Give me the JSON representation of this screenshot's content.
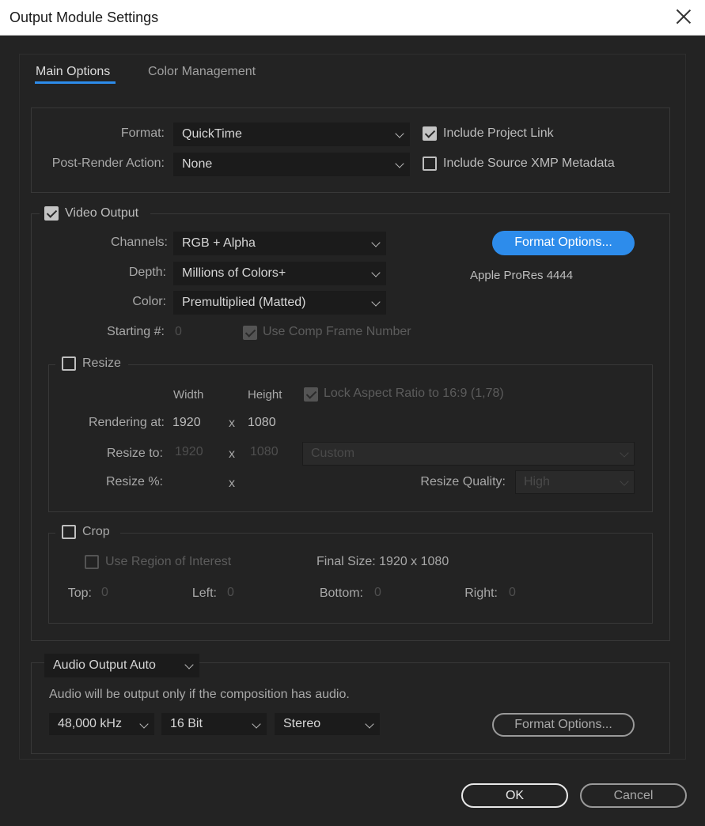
{
  "window": {
    "title": "Output Module Settings"
  },
  "tabs": [
    {
      "label": "Main Options",
      "active": true
    },
    {
      "label": "Color Management",
      "active": false
    }
  ],
  "format_section": {
    "format_label": "Format:",
    "format_value": "QuickTime",
    "post_render_label": "Post-Render Action:",
    "post_render_value": "None",
    "include_project_link": {
      "label": "Include Project Link",
      "checked": true
    },
    "include_xmp": {
      "label": "Include Source XMP Metadata",
      "checked": false
    }
  },
  "video_output": {
    "label": "Video Output",
    "checked": true,
    "channels_label": "Channels:",
    "channels_value": "RGB + Alpha",
    "depth_label": "Depth:",
    "depth_value": "Millions of Colors+",
    "color_label": "Color:",
    "color_value": "Premultiplied (Matted)",
    "starting_label": "Starting #:",
    "starting_value": "0",
    "use_comp_frame": {
      "label": "Use Comp Frame Number",
      "checked": true
    },
    "format_options_label": "Format Options...",
    "codec_info": "Apple ProRes 4444"
  },
  "resize": {
    "label": "Resize",
    "checked": false,
    "width_header": "Width",
    "height_header": "Height",
    "lock_aspect": {
      "label": "Lock Aspect Ratio to 16:9 (1,78)",
      "checked": true
    },
    "rendering_at_label": "Rendering at:",
    "rendering_w": "1920",
    "rendering_h": "1080",
    "x": "x",
    "resize_to_label": "Resize to:",
    "resize_to_w": "1920",
    "resize_to_h": "1080",
    "resize_preset": "Custom",
    "resize_pct_label": "Resize %:",
    "resize_quality_label": "Resize Quality:",
    "resize_quality_value": "High"
  },
  "crop": {
    "label": "Crop",
    "checked": false,
    "use_roi": {
      "label": "Use Region of Interest",
      "checked": false
    },
    "final_size": "Final Size: 1920 x 1080",
    "top_label": "Top:",
    "top_value": "0",
    "left_label": "Left:",
    "left_value": "0",
    "bottom_label": "Bottom:",
    "bottom_value": "0",
    "right_label": "Right:",
    "right_value": "0"
  },
  "audio": {
    "mode": "Audio Output Auto",
    "note": "Audio will be output only if the composition has audio.",
    "sample_rate": "48,000 kHz",
    "bit_depth": "16 Bit",
    "channels": "Stereo",
    "format_options_label": "Format Options..."
  },
  "footer": {
    "ok_label": "OK",
    "cancel_label": "Cancel"
  },
  "colors": {
    "accent": "#2d8ceb",
    "background": "#232323"
  }
}
